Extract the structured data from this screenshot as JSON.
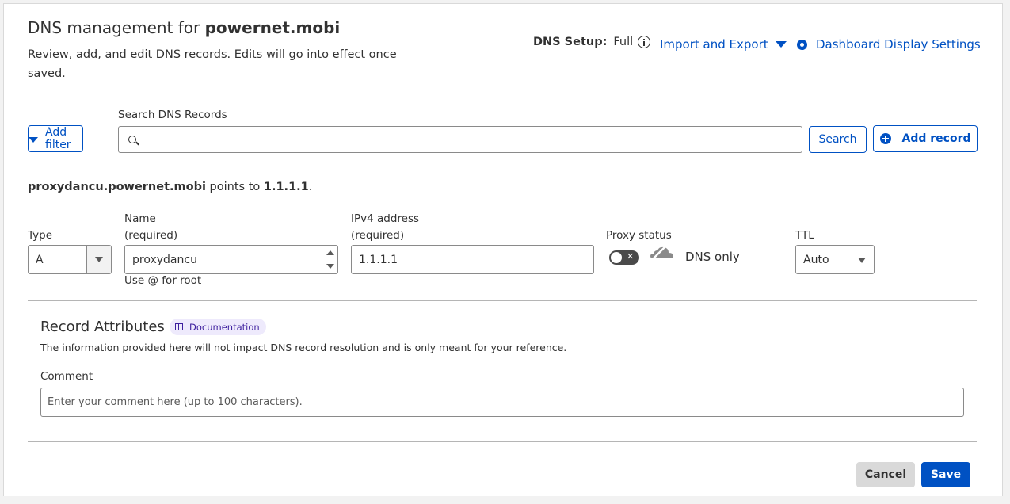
{
  "header": {
    "title_prefix": "DNS management for ",
    "title_domain": "powernet.mobi",
    "subtitle": "Review, add, and edit DNS records. Edits will go into effect once saved.",
    "dns_setup_label": "DNS Setup:",
    "dns_setup_value": "Full",
    "import_export_label": "Import and Export",
    "dashboard_settings_label": "Dashboard Display Settings"
  },
  "toolbar": {
    "add_filter_label": "Add filter",
    "search_label": "Search DNS Records",
    "search_button_label": "Search",
    "add_record_label": "Add record"
  },
  "record": {
    "fqdn": "proxydancu.powernet.mobi",
    "points_to_text": " points to ",
    "target": "1.1.1.1",
    "end": "."
  },
  "form": {
    "type_label": "Type",
    "type_value": "A",
    "name_label": "Name",
    "name_required": "(required)",
    "name_value": "proxydancu",
    "name_help": "Use @ for root",
    "ipv4_label": "IPv4 address",
    "ipv4_required": "(required)",
    "ipv4_value": "1.1.1.1",
    "proxy_label": "Proxy status",
    "proxy_value": "DNS only",
    "proxy_enabled": false,
    "ttl_label": "TTL",
    "ttl_value": "Auto"
  },
  "attributes": {
    "title": "Record Attributes",
    "documentation_label": "Documentation",
    "description": "The information provided here will not impact DNS record resolution and is only meant for your reference.",
    "comment_label": "Comment",
    "comment_placeholder": "Enter your comment here (up to 100 characters)."
  },
  "actions": {
    "cancel_label": "Cancel",
    "save_label": "Save"
  },
  "colors": {
    "accent": "#0051c3",
    "doc_badge_bg": "#eeeafc",
    "toggle_off": "#4a4a4a"
  }
}
